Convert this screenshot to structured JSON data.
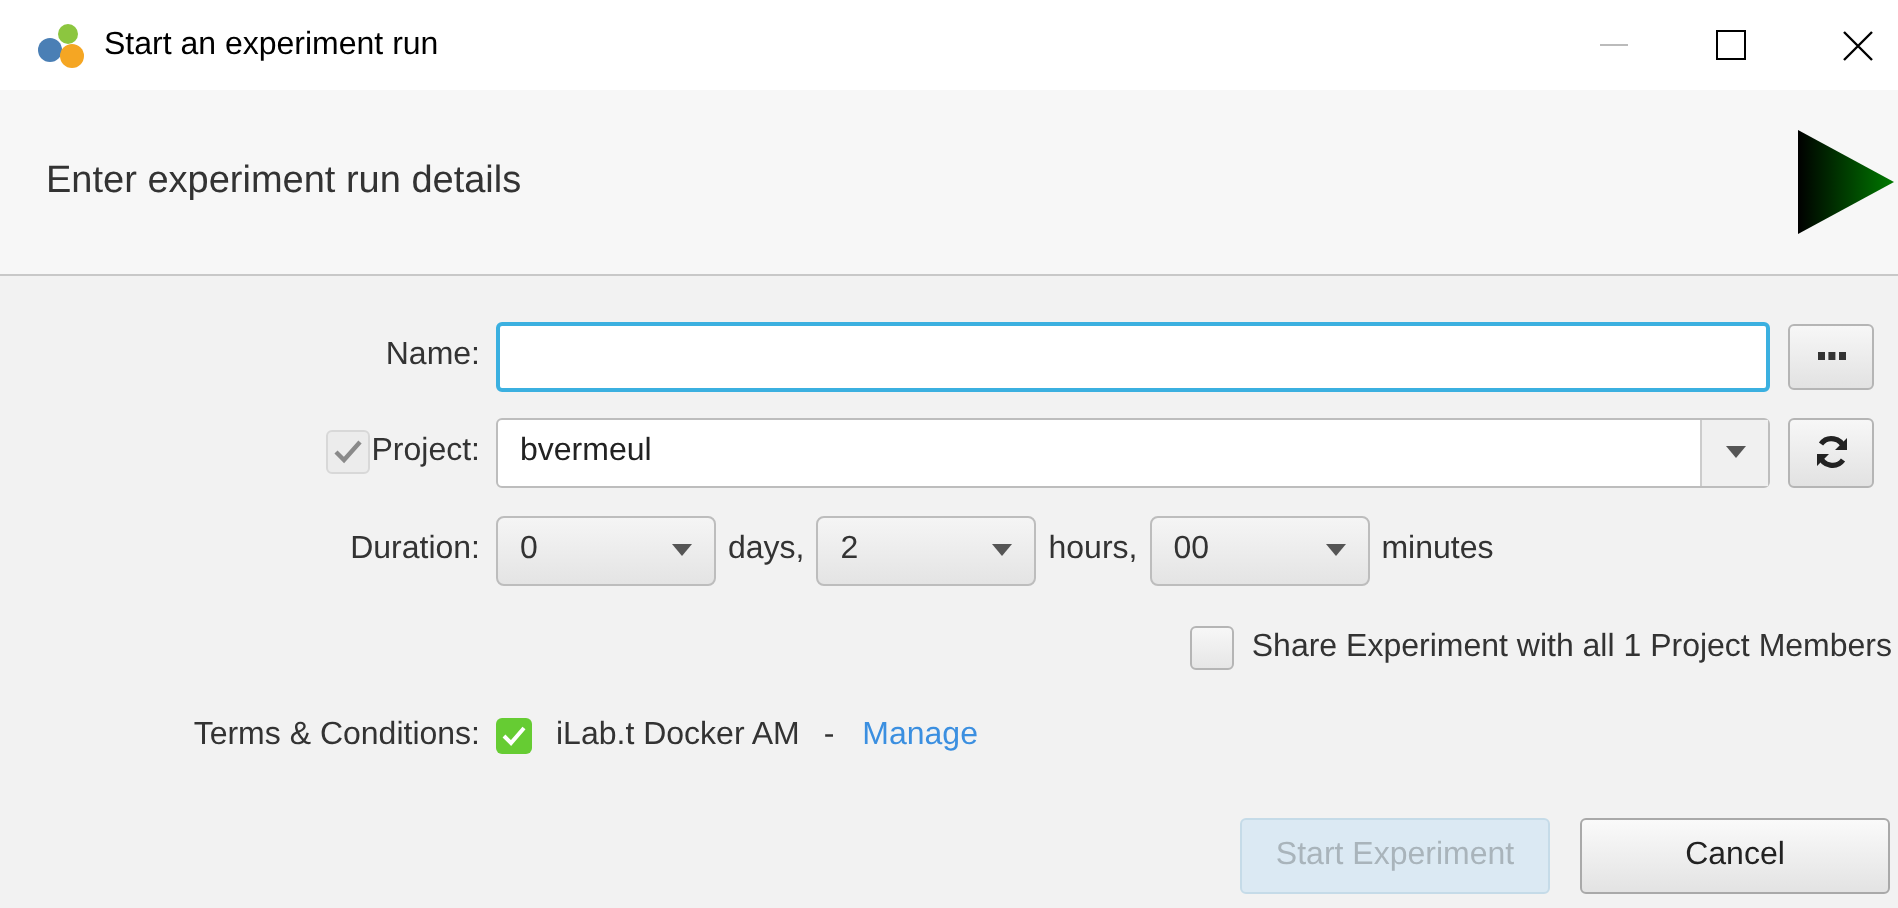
{
  "window": {
    "title": "Start an experiment run"
  },
  "header": {
    "title": "Enter experiment run details"
  },
  "name_field": {
    "label": "Name:"
  },
  "project": {
    "label": "Project:",
    "checked": true,
    "disabled": true,
    "value": "bvermeul"
  },
  "duration": {
    "label": "Duration:",
    "parts": [
      {
        "value": "0",
        "unit": "days,"
      },
      {
        "value": "2",
        "unit": "hours,"
      },
      {
        "value": "00",
        "unit": "minutes"
      }
    ]
  },
  "share": {
    "label": "Share Experiment with all 1 Project Members",
    "checked": false
  },
  "terms": {
    "label": "Terms & Conditions:",
    "checked": true,
    "item": "iLab.t Docker AM",
    "separator": "-",
    "link": "Manage"
  },
  "buttons": [
    {
      "label": "Start Experiment",
      "disabled": true
    },
    {
      "label": "Cancel",
      "disabled": false
    }
  ]
}
